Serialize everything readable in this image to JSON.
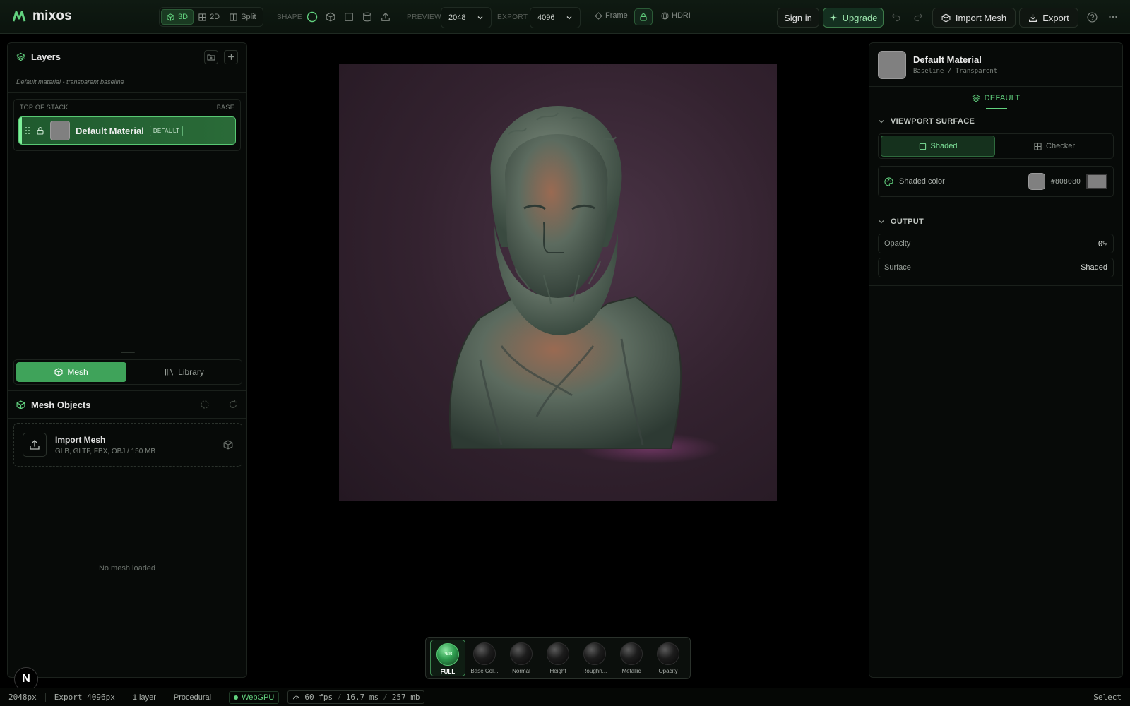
{
  "app": {
    "name": "mixos",
    "brand_color": "#62d27f"
  },
  "toolbar": {
    "modes": [
      {
        "label": "3D",
        "icon": "cube-icon",
        "active": true
      },
      {
        "label": "2D",
        "icon": "grid-icon",
        "active": false
      },
      {
        "label": "Split",
        "icon": "split-icon",
        "active": false
      }
    ],
    "shape_label": "SHAPE",
    "shapes": [
      "sphere-icon",
      "cube-icon",
      "plane-icon",
      "cylinder-icon",
      "upload-icon"
    ],
    "preview_label": "PREVIEW",
    "preview_value": "2048",
    "export_label": "EXPORT",
    "export_value": "4096",
    "frame_label": "Frame",
    "hdri_label": "HDRI",
    "sign_in": "Sign in",
    "upgrade": "Upgrade",
    "import_mesh": "Import Mesh",
    "export": "Export"
  },
  "layers": {
    "title": "Layers",
    "subtitle": "Default material - transparent baseline",
    "stack_top": "TOP OF STACK",
    "stack_base": "BASE",
    "items": [
      {
        "name": "Default Material",
        "badge": "DEFAULT",
        "swatch": "#808080"
      }
    ]
  },
  "bottom_tabs": [
    {
      "label": "Mesh",
      "active": true
    },
    {
      "label": "Library",
      "active": false
    }
  ],
  "mesh_objects": {
    "title": "Mesh Objects",
    "import_title": "Import Mesh",
    "import_sub": "GLB, GLTF, FBX, OBJ / 150 MB",
    "empty": "No mesh loaded"
  },
  "pbr_channels": [
    {
      "label": "FULL",
      "active": true,
      "ball_text": "PBR"
    },
    {
      "label": "Base Col...",
      "active": false
    },
    {
      "label": "Normal",
      "active": false
    },
    {
      "label": "Height",
      "active": false
    },
    {
      "label": "Roughn...",
      "active": false
    },
    {
      "label": "Metallic",
      "active": false
    },
    {
      "label": "Opacity",
      "active": false
    }
  ],
  "material": {
    "title": "Default Material",
    "subtitle": "Baseline / Transparent",
    "tab": "DEFAULT",
    "viewport_surface": "VIEWPORT SURFACE",
    "surface_options": [
      {
        "label": "Shaded",
        "active": true
      },
      {
        "label": "Checker",
        "active": false
      }
    ],
    "shaded_color_label": "Shaded color",
    "shaded_color": "#808080",
    "output": "OUTPUT",
    "opacity_label": "Opacity",
    "opacity_value": "0%",
    "surface_label": "Surface",
    "surface_value": "Shaded"
  },
  "status": {
    "res": "2048px",
    "export": "Export 4096px",
    "layers": "1 layer",
    "mode": "Procedural",
    "backend": "WebGPU",
    "fps": "60 fps",
    "ms": "16.7 ms",
    "mem": "257 mb",
    "tool": "Select"
  }
}
